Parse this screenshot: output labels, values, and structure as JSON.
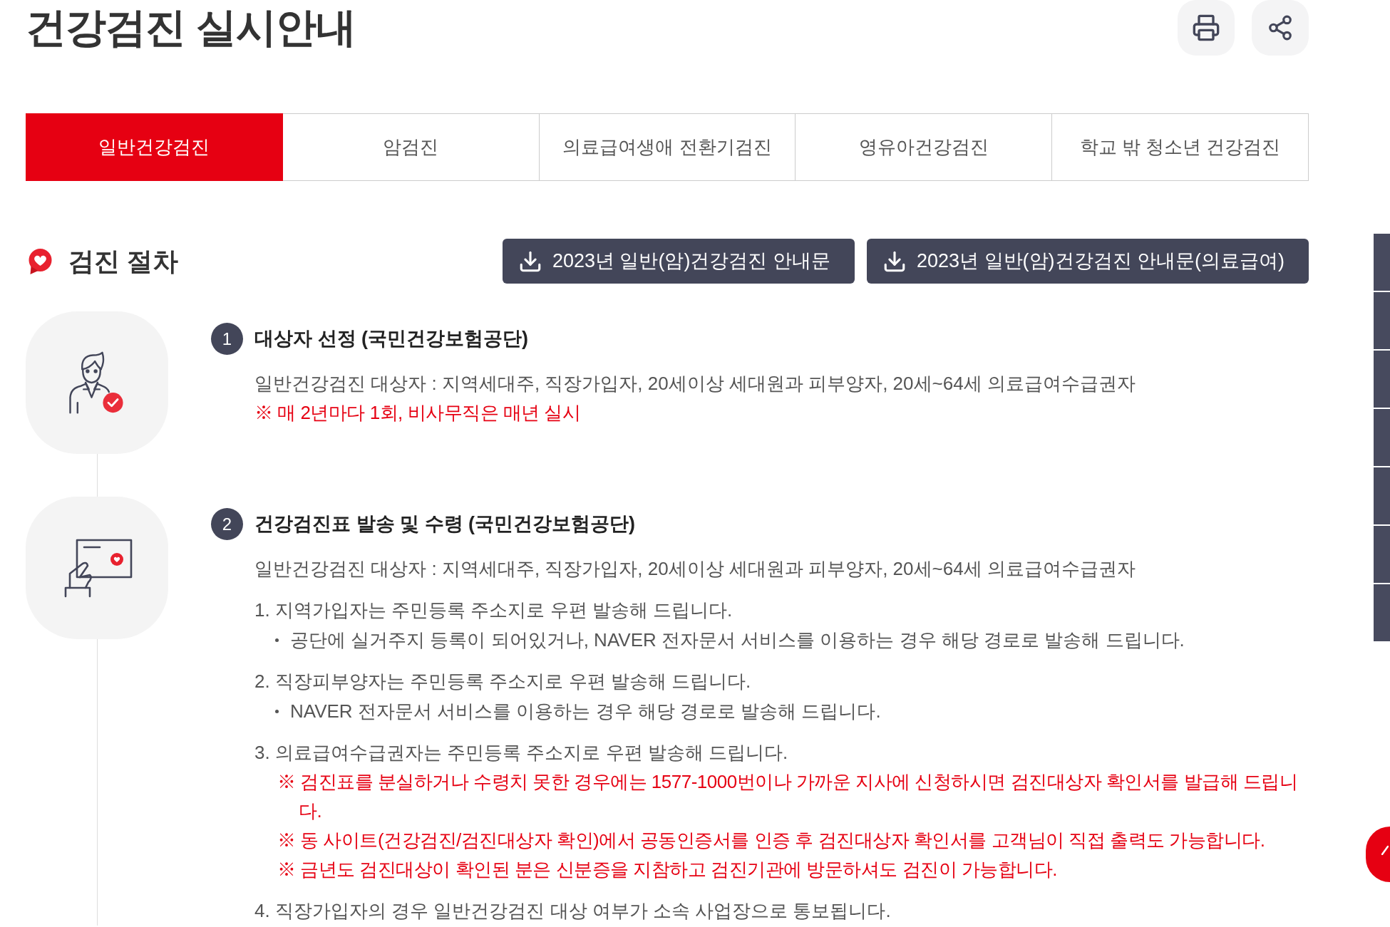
{
  "page": {
    "title": "건강검진 실시안내"
  },
  "tabs": [
    {
      "label": "일반건강검진",
      "selected": true
    },
    {
      "label": "암검진",
      "selected": false
    },
    {
      "label": "의료급여생애 전환기검진",
      "selected": false
    },
    {
      "label": "영유아건강검진",
      "selected": false
    },
    {
      "label": "학교 밖 청소년 건강검진",
      "selected": false
    }
  ],
  "section": {
    "title": "검진 절차",
    "downloads": [
      "2023년 일반(암)건강검진 안내문",
      "2023년 일반(암)건강검진 안내문(의료급여)"
    ]
  },
  "steps": [
    {
      "number": "1",
      "title": "대상자 선정 (국민건강보험공단)",
      "content": [
        {
          "kind": "text",
          "text": "일반건강검진 대상자 : 지역세대주, 직장가입자, 20세이상 세대원과 피부양자, 20세~64세 의료급여수급권자"
        },
        {
          "kind": "note",
          "text": "※ 매 2년마다 1회, 비사무직은 매년 실시"
        }
      ]
    },
    {
      "number": "2",
      "title": "건강검진표 발송 및 수령 (국민건강보험공단)",
      "content": [
        {
          "kind": "text",
          "text": "일반건강검진 대상자 : 지역세대주, 직장가입자, 20세이상 세대원과 피부양자, 20세~64세 의료급여수급권자"
        },
        {
          "kind": "item",
          "text": "1. 지역가입자는 주민등록 주소지로 우편 발송해 드립니다.",
          "children": [
            {
              "kind": "bullet",
              "text": "공단에 실거주지 등록이 되어있거나, NAVER 전자문서 서비스를 이용하는 경우 해당 경로로 발송해 드립니다."
            }
          ]
        },
        {
          "kind": "item",
          "text": "2. 직장피부양자는 주민등록 주소지로 우편 발송해 드립니다.",
          "children": [
            {
              "kind": "bullet",
              "text": "NAVER 전자문서 서비스를 이용하는 경우 해당 경로로 발송해 드립니다."
            }
          ]
        },
        {
          "kind": "item",
          "text": "3. 의료급여수급권자는 주민등록 주소지로 우편 발송해 드립니다.",
          "children": [
            {
              "kind": "note",
              "text": "※ 검진표를 분실하거나 수령치 못한 경우에는 1577-1000번이나 가까운 지사에 신청하시면 검진대상자 확인서를 발급해 드립니다."
            },
            {
              "kind": "note",
              "text": "※ 동 사이트(건강검진/검진대상자 확인)에서 공동인증서를 인증 후 검진대상자 확인서를 고객님이 직접 출력도 가능합니다."
            },
            {
              "kind": "note",
              "text": "※ 금년도 검진대상이 확인된 분은 신분증을 지참하고 검진기관에 방문하셔도 검진이 가능합니다."
            }
          ]
        },
        {
          "kind": "item",
          "text": "4. 직장가입자의 경우 일반건강검진 대상 여부가 소속 사업장으로 통보됩니다."
        }
      ]
    }
  ]
}
